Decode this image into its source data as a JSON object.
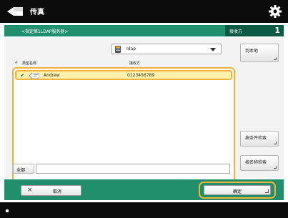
{
  "header": {
    "title": "传真",
    "app_icon": "fax-machine-icon",
    "settings_icon": "gear-icon"
  },
  "subheader": {
    "title": "<指定第1LDAP服务器>",
    "count_label": "接收方",
    "count_value": "1"
  },
  "server_select": {
    "value": "Idap",
    "icon": "server-icon"
  },
  "buttons": {
    "to_local": "到本地",
    "search_by_condition": "按条件检索",
    "search_by_name": "按名称检索",
    "all": "全部",
    "cancel": "取消",
    "cancel_icon": "×",
    "ok": "确定"
  },
  "list": {
    "columns": {
      "check": "✔",
      "type": "类型",
      "name": "名称",
      "destination": "接收方"
    },
    "rows": [
      {
        "checked": "✔",
        "type_icon": "contact-card-icon",
        "name": "Andrew",
        "destination": "0123456789"
      }
    ]
  },
  "search": {
    "value": ""
  },
  "colors": {
    "accent_green": "#218e6c",
    "dark_green": "#0b5a43",
    "highlight": "#f3b23a",
    "selected_row": "#fff2ad"
  }
}
